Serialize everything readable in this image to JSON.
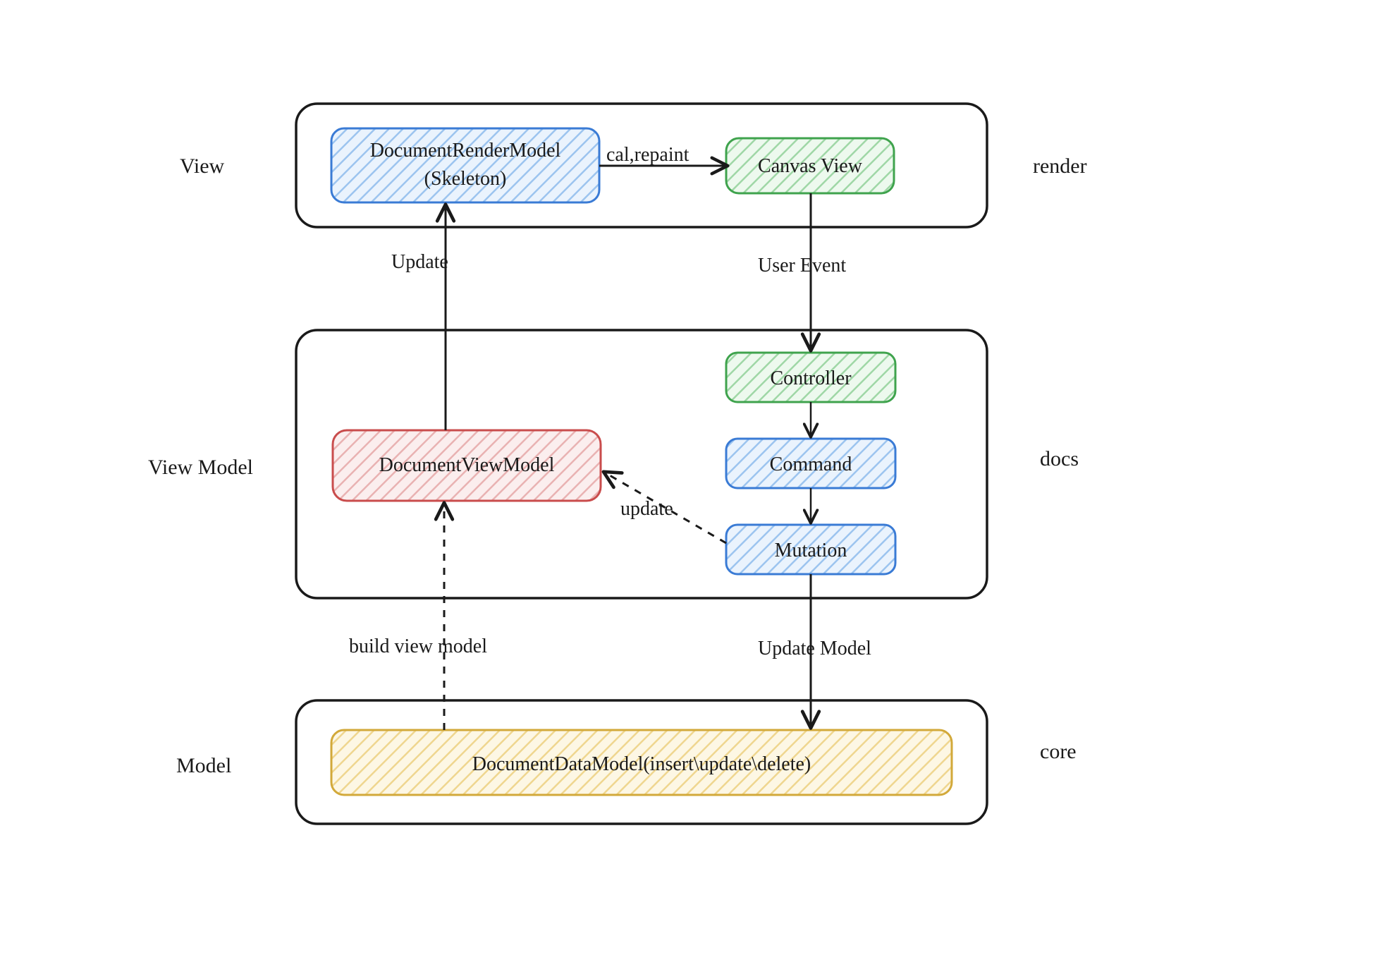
{
  "layerLabels": {
    "view": "View",
    "viewModel": "View Model",
    "model": "Model"
  },
  "moduleLabels": {
    "render": "render",
    "docs": "docs",
    "core": "core"
  },
  "nodes": {
    "documentRenderModel": {
      "line1": "DocumentRenderModel",
      "line2": "(Skeleton)"
    },
    "canvasView": "Canvas View",
    "documentViewModel": "DocumentViewModel",
    "controller": "Controller",
    "command": "Command",
    "mutation": "Mutation",
    "documentDataModel": "DocumentDataModel(insert\\update\\delete)"
  },
  "edges": {
    "calRepaint": "cal,repaint",
    "userEvent": "User Event",
    "update": "Update",
    "updateLower": "update",
    "buildViewModel": "build view model",
    "updateModel": "Update Model"
  },
  "colors": {
    "blueStroke": "#3a7bd5",
    "blueFill": "#cfe4fb",
    "greenStroke": "#3fa34d",
    "greenFill": "#d2f0d6",
    "redStroke": "#c94c4c",
    "redFill": "#f6d4d4",
    "yellowStroke": "#d2a93a",
    "yellowFill": "#fbf0c9",
    "ink": "#1a1a1a"
  }
}
